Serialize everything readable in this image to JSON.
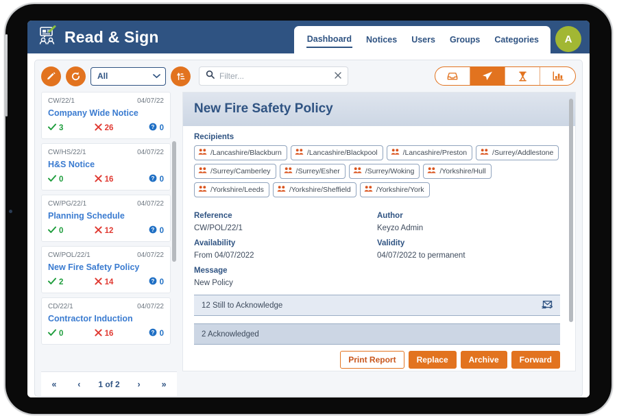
{
  "app": {
    "title": "Read & Sign",
    "logo_icon": "read-sign-logo-icon"
  },
  "nav": {
    "items": [
      {
        "label": "Dashboard",
        "active": true
      },
      {
        "label": "Notices",
        "active": false
      },
      {
        "label": "Users",
        "active": false
      },
      {
        "label": "Groups",
        "active": false
      },
      {
        "label": "Categories",
        "active": false
      }
    ],
    "avatar_initial": "A",
    "avatar_color": "#a2b733"
  },
  "toolbar": {
    "edit_icon": "pencil-icon",
    "refresh_icon": "refresh-icon",
    "sort_icon": "sort-ascending-icon",
    "filter_select_value": "All",
    "filter_select_options": [
      "All"
    ],
    "search_placeholder": "Filter...",
    "search_value": "",
    "search_icon": "search-icon",
    "clear_icon": "close-icon",
    "segments": [
      {
        "icon": "inbox-icon",
        "active": false
      },
      {
        "icon": "paper-plane-icon",
        "active": true
      },
      {
        "icon": "hourglass-icon",
        "active": false
      },
      {
        "icon": "bar-chart-icon",
        "active": false
      }
    ]
  },
  "notice_list": {
    "items": [
      {
        "reference": "CW/22/1",
        "date": "04/07/22",
        "title": "Company Wide Notice",
        "acknowledged": "3",
        "pending": "26",
        "queries": "0"
      },
      {
        "reference": "CW/HS/22/1",
        "date": "04/07/22",
        "title": "H&S Notice",
        "acknowledged": "0",
        "pending": "16",
        "queries": "0"
      },
      {
        "reference": "CW/PG/22/1",
        "date": "04/07/22",
        "title": "Planning Schedule",
        "acknowledged": "0",
        "pending": "12",
        "queries": "0"
      },
      {
        "reference": "CW/POL/22/1",
        "date": "04/07/22",
        "title": "New Fire Safety Policy",
        "acknowledged": "2",
        "pending": "14",
        "queries": "0"
      },
      {
        "reference": "CD/22/1",
        "date": "04/07/22",
        "title": "Contractor Induction",
        "acknowledged": "0",
        "pending": "16",
        "queries": "0"
      }
    ]
  },
  "pagination": {
    "first_label": "«",
    "prev_label": "‹",
    "indicator": "1 of 2",
    "next_label": "›",
    "last_label": "»"
  },
  "detail": {
    "title": "New Fire Safety Policy",
    "recipients_label": "Recipients",
    "recipients": [
      "/Lancashire/Blackburn",
      "/Lancashire/Blackpool",
      "/Lancashire/Preston",
      "/Surrey/Addlestone",
      "/Surrey/Camberley",
      "/Surrey/Esher",
      "/Surrey/Woking",
      "/Yorkshire/Hull",
      "/Yorkshire/Leeds",
      "/Yorkshire/Sheffield",
      "/Yorkshire/York"
    ],
    "recipient_icon": "group-users-icon",
    "fields": {
      "reference_label": "Reference",
      "reference_value": "CW/POL/22/1",
      "author_label": "Author",
      "author_value": "Keyzo Admin",
      "availability_label": "Availability",
      "availability_value": "From 04/07/2022",
      "validity_label": "Validity",
      "validity_value": "04/07/2022 to permanent",
      "message_label": "Message",
      "message_value": "New Policy"
    },
    "status_bars": [
      {
        "text": "12 Still to Acknowledge",
        "icon": "send-envelope-icon"
      },
      {
        "text": "2 Acknowledged",
        "icon": ""
      }
    ],
    "actions": [
      {
        "label": "Print Report",
        "style": "outline"
      },
      {
        "label": "Replace",
        "style": "filled"
      },
      {
        "label": "Archive",
        "style": "filled"
      },
      {
        "label": "Forward",
        "style": "filled"
      }
    ]
  },
  "colors": {
    "header_blue": "#2f5382",
    "accent_orange": "#e2731f",
    "link_blue": "#3a7bd0",
    "success_green": "#1f9d3d",
    "danger_red": "#e03a32"
  }
}
